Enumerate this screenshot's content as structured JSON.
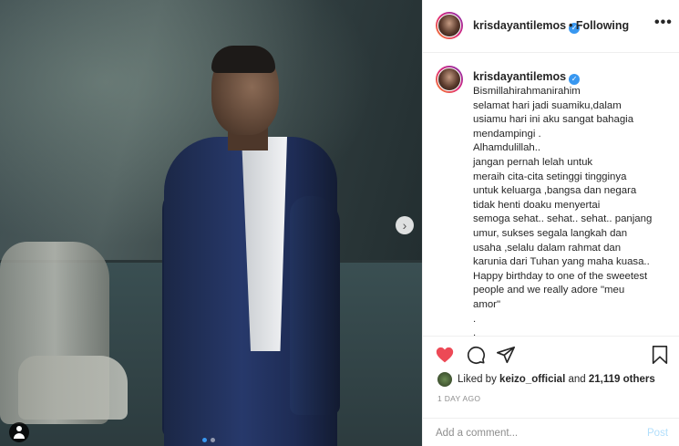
{
  "post": {
    "image_count": 2,
    "active_image": 1
  },
  "header": {
    "username": "krisdayantilemos",
    "follow_status": "• Following",
    "more_label": "•••"
  },
  "caption": {
    "username": "krisdayantilemos",
    "lines": [
      "Bismillahirahmanirahim",
      "selamat hari jadi suamiku,dalam",
      "usiamu hari ini aku sangat bahagia",
      "mendampingi .",
      "Alhamdulillah..",
      "jangan pernah lelah untuk",
      "meraih cita-cita setinggi tingginya",
      "untuk keluarga ,bangsa dan negara",
      "tidak henti doaku menyertai",
      "semoga sehat.. sehat.. sehat.. panjang",
      "umur, sukses segala langkah dan",
      "usaha ,selalu dalam rahmat dan",
      "karunia dari Tuhan yang maha kuasa..",
      "Happy birthday to one of the sweetest",
      "people and we really adore \"meu",
      "amor\"",
      ".",
      "."
    ]
  },
  "likes": {
    "prefix": "Liked by",
    "liker": "keizo_official",
    "connector": "and",
    "others": "21,119 others"
  },
  "timestamp": "1 DAY AGO",
  "comment": {
    "placeholder": "Add a comment...",
    "post_label": "Post"
  },
  "colors": {
    "like_red": "#ed4956",
    "verified_blue": "#3897f0",
    "post_disabled": "#b2dffc"
  },
  "icons": [
    "heart-icon",
    "comment-icon",
    "share-icon",
    "bookmark-icon",
    "next-arrow-icon",
    "user-tag-icon",
    "verified-icon"
  ]
}
